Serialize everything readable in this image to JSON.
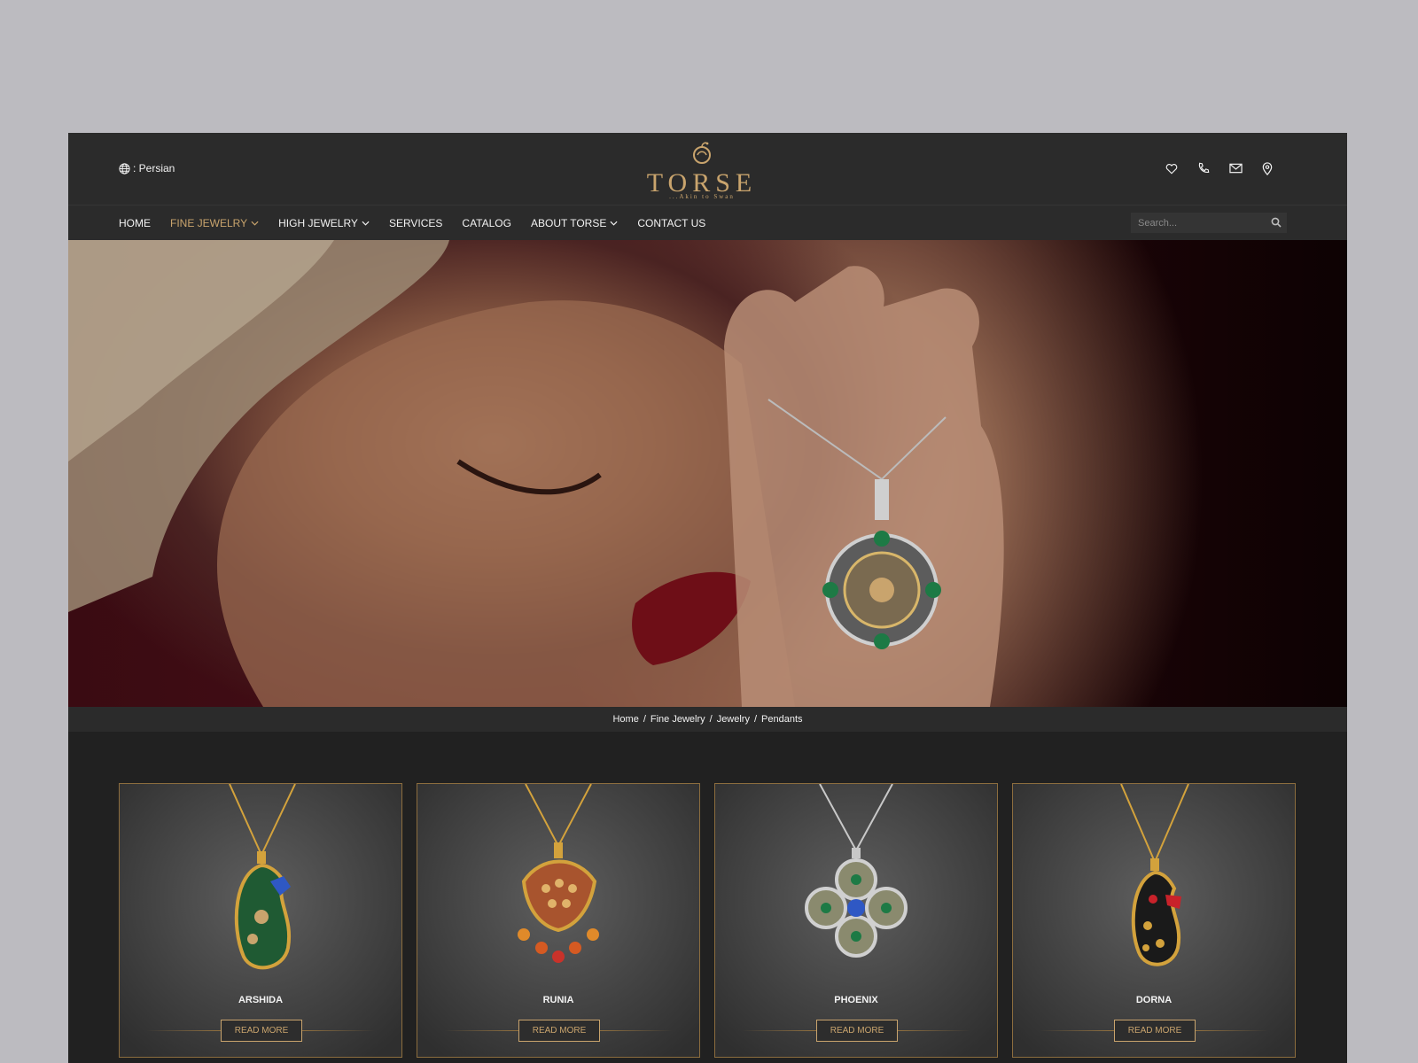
{
  "header": {
    "language_label": ": Persian",
    "logo_word": "TORSE",
    "logo_tagline": "...Akin to Swan",
    "icons": [
      "heart-icon",
      "phone-icon",
      "mail-icon",
      "location-pin-icon"
    ]
  },
  "nav": {
    "items": [
      {
        "label": "HOME",
        "dropdown": false,
        "active": false
      },
      {
        "label": "FINE JEWELRY",
        "dropdown": true,
        "active": true
      },
      {
        "label": "HIGH JEWELRY",
        "dropdown": true,
        "active": false
      },
      {
        "label": "SERVICES",
        "dropdown": false,
        "active": false
      },
      {
        "label": "CATALOG",
        "dropdown": false,
        "active": false
      },
      {
        "label": "ABOUT TORSE",
        "dropdown": true,
        "active": false
      },
      {
        "label": "CONTACT US",
        "dropdown": false,
        "active": false
      }
    ],
    "search_placeholder": "Search..."
  },
  "breadcrumb": [
    "Home",
    "Fine Jewelry",
    "Jewelry",
    "Pendants"
  ],
  "products": [
    {
      "name": "ARSHIDA",
      "button": "READ MORE",
      "chain": "gold",
      "stone": "green-blue"
    },
    {
      "name": "RUNIA",
      "button": "READ MORE",
      "chain": "gold",
      "stone": "orange-red"
    },
    {
      "name": "PHOENIX",
      "button": "READ MORE",
      "chain": "silver",
      "stone": "blue-green"
    },
    {
      "name": "DORNA",
      "button": "READ MORE",
      "chain": "gold",
      "stone": "black-red"
    }
  ],
  "colors": {
    "accent_gold": "#c9a46d",
    "header_bg": "#2b2b2b",
    "page_bg": "#212121",
    "outer_bg": "#bcbbc0"
  }
}
